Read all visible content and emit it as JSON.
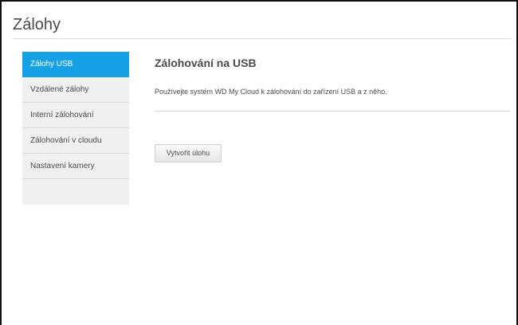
{
  "page": {
    "title": "Zálohy"
  },
  "sidebar": {
    "items": [
      {
        "label": "Zálohy USB"
      },
      {
        "label": "Vzdálené zálohy"
      },
      {
        "label": "Interní zálohování"
      },
      {
        "label": "Zálohování v cloudu"
      },
      {
        "label": "Nastavení kamery"
      }
    ],
    "active_index": 0
  },
  "main": {
    "heading": "Zálohování na USB",
    "description": "Používejte systém WD My Cloud k zálohování do zařízení USB a z něho.",
    "create_button_label": "Vytvořit úlohu"
  },
  "colors": {
    "accent": "#16a1e6",
    "sidebar_bg": "#f0f0f0",
    "text": "#4a4a4a"
  }
}
